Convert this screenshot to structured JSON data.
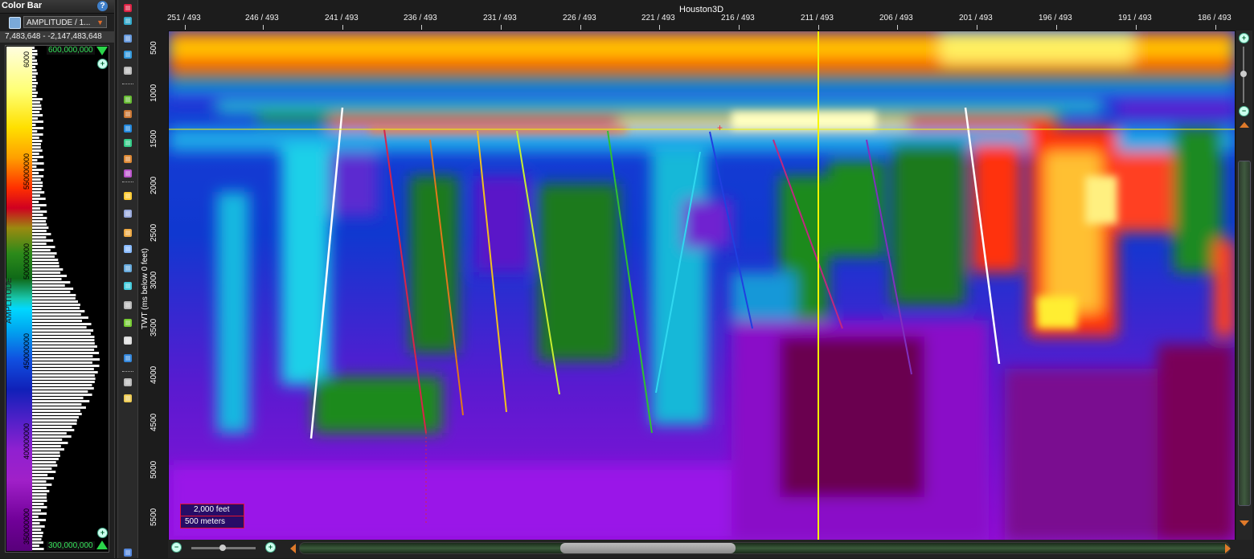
{
  "color_bar_panel": {
    "title": "Color Bar",
    "help_icon": "?",
    "attribute": "AMPLITUDE / 1...",
    "range": "7,483,648 - -2,147,483,648",
    "axis_title": "AMPLITUDE",
    "ticks": [
      "6000",
      "550000000",
      "500000000",
      "450000000",
      "400000000",
      "350000000",
      "300000"
    ],
    "max_value": "600,000,000",
    "min_value": "300,000,000"
  },
  "viewer": {
    "title": "Houston3D",
    "x_ticks": [
      "251 / 493",
      "246 / 493",
      "241 / 493",
      "236 / 493",
      "231 / 493",
      "226 / 493",
      "221 / 493",
      "216 / 493",
      "211 / 493",
      "206 / 493",
      "201 / 493",
      "196 / 493",
      "191 / 493",
      "186 / 493"
    ],
    "y_ticks": [
      "500",
      "1000",
      "1500",
      "2000",
      "2500",
      "3000",
      "3500",
      "4000",
      "4500",
      "5000",
      "5500"
    ],
    "y_axis_title": "TWT (ms below 0 feet)",
    "scale_feet": "2,000 feet",
    "scale_meters": "500 meters",
    "crosshair_color": "#f5f500"
  },
  "fault_colors": [
    "#ffffff",
    "#d8244a",
    "#e0781c",
    "#f0c020",
    "#c8f030",
    "#30c030",
    "#30d8f0",
    "#2040e0",
    "#c02880",
    "#8030c0",
    "#ffffff"
  ],
  "icons": [
    "help-icon",
    "attribute-icon",
    "zoom-in-icon",
    "zoom-out-icon",
    "rotate-icon",
    "select-icon",
    "pan-icon",
    "horizon-icon",
    "fault-icon",
    "ruler-icon",
    "layers-icon",
    "window-icon",
    "pencil-icon"
  ]
}
